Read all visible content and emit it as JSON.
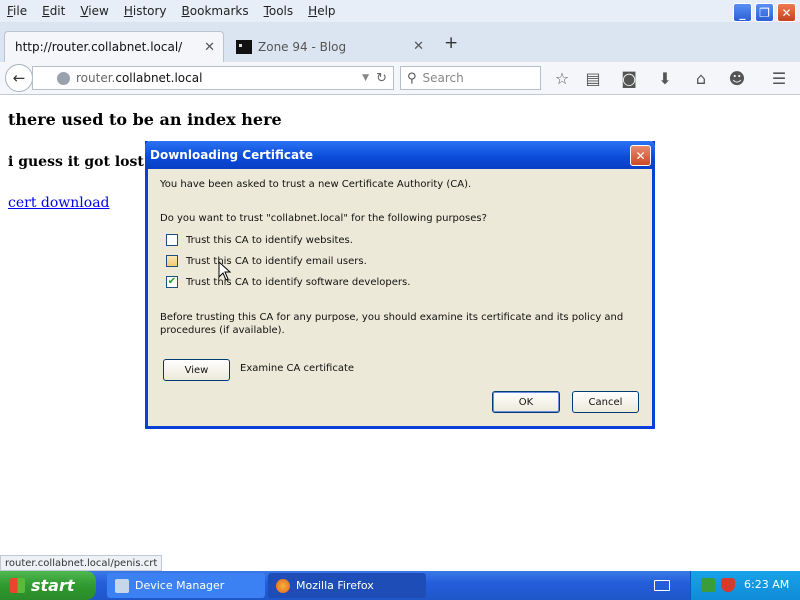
{
  "menubar": {
    "items": [
      "File",
      "Edit",
      "View",
      "History",
      "Bookmarks",
      "Tools",
      "Help"
    ]
  },
  "tabs": [
    {
      "label": "http://router.collabnet.local/",
      "active": true
    },
    {
      "label": "Zone 94 - Blog",
      "active": false
    }
  ],
  "navbar": {
    "url_prefix": "router.",
    "url_domain": "collabnet.local",
    "search_placeholder": "Search",
    "icons": [
      "back-icon",
      "globe-icon",
      "dropdown-icon",
      "reload-icon",
      "search-icon",
      "bookmark-star-icon",
      "reading-list-icon",
      "pocket-icon",
      "download-icon",
      "home-icon",
      "hello-icon",
      "menu-icon"
    ]
  },
  "page": {
    "heading": "there used to be an index here",
    "subheading": "i guess it got lost some",
    "link": "cert download"
  },
  "dialog": {
    "title": "Downloading Certificate",
    "intro": "You have been asked to trust a new Certificate Authority (CA).",
    "question": "Do you want to trust \"collabnet.local\" for the following purposes?",
    "options": [
      {
        "label": "Trust this CA to identify websites.",
        "checked": false
      },
      {
        "label": "Trust this CA to identify email users.",
        "checked": false
      },
      {
        "label": "Trust this CA to identify software developers.",
        "checked": true
      }
    ],
    "advice": "Before trusting this CA for any purpose, you should examine its certificate and its policy and procedures (if available).",
    "view_button": "View",
    "view_caption": "Examine CA certificate",
    "ok_button": "OK",
    "cancel_button": "Cancel"
  },
  "status": {
    "link_preview": "router.collabnet.local/penis.crt"
  },
  "taskbar": {
    "start_label": "start",
    "tasks": [
      {
        "label": "Device Manager",
        "active": false
      },
      {
        "label": "Mozilla Firefox",
        "active": true
      }
    ],
    "clock": "6:23 AM"
  },
  "colors": {
    "title_bar_blue": "#0a4ad8",
    "taskbar_blue": "#245edb",
    "start_green": "#2f9a2f",
    "dialog_face": "#ece9d8",
    "link_blue": "#0000ee",
    "check_green": "#21a121"
  }
}
